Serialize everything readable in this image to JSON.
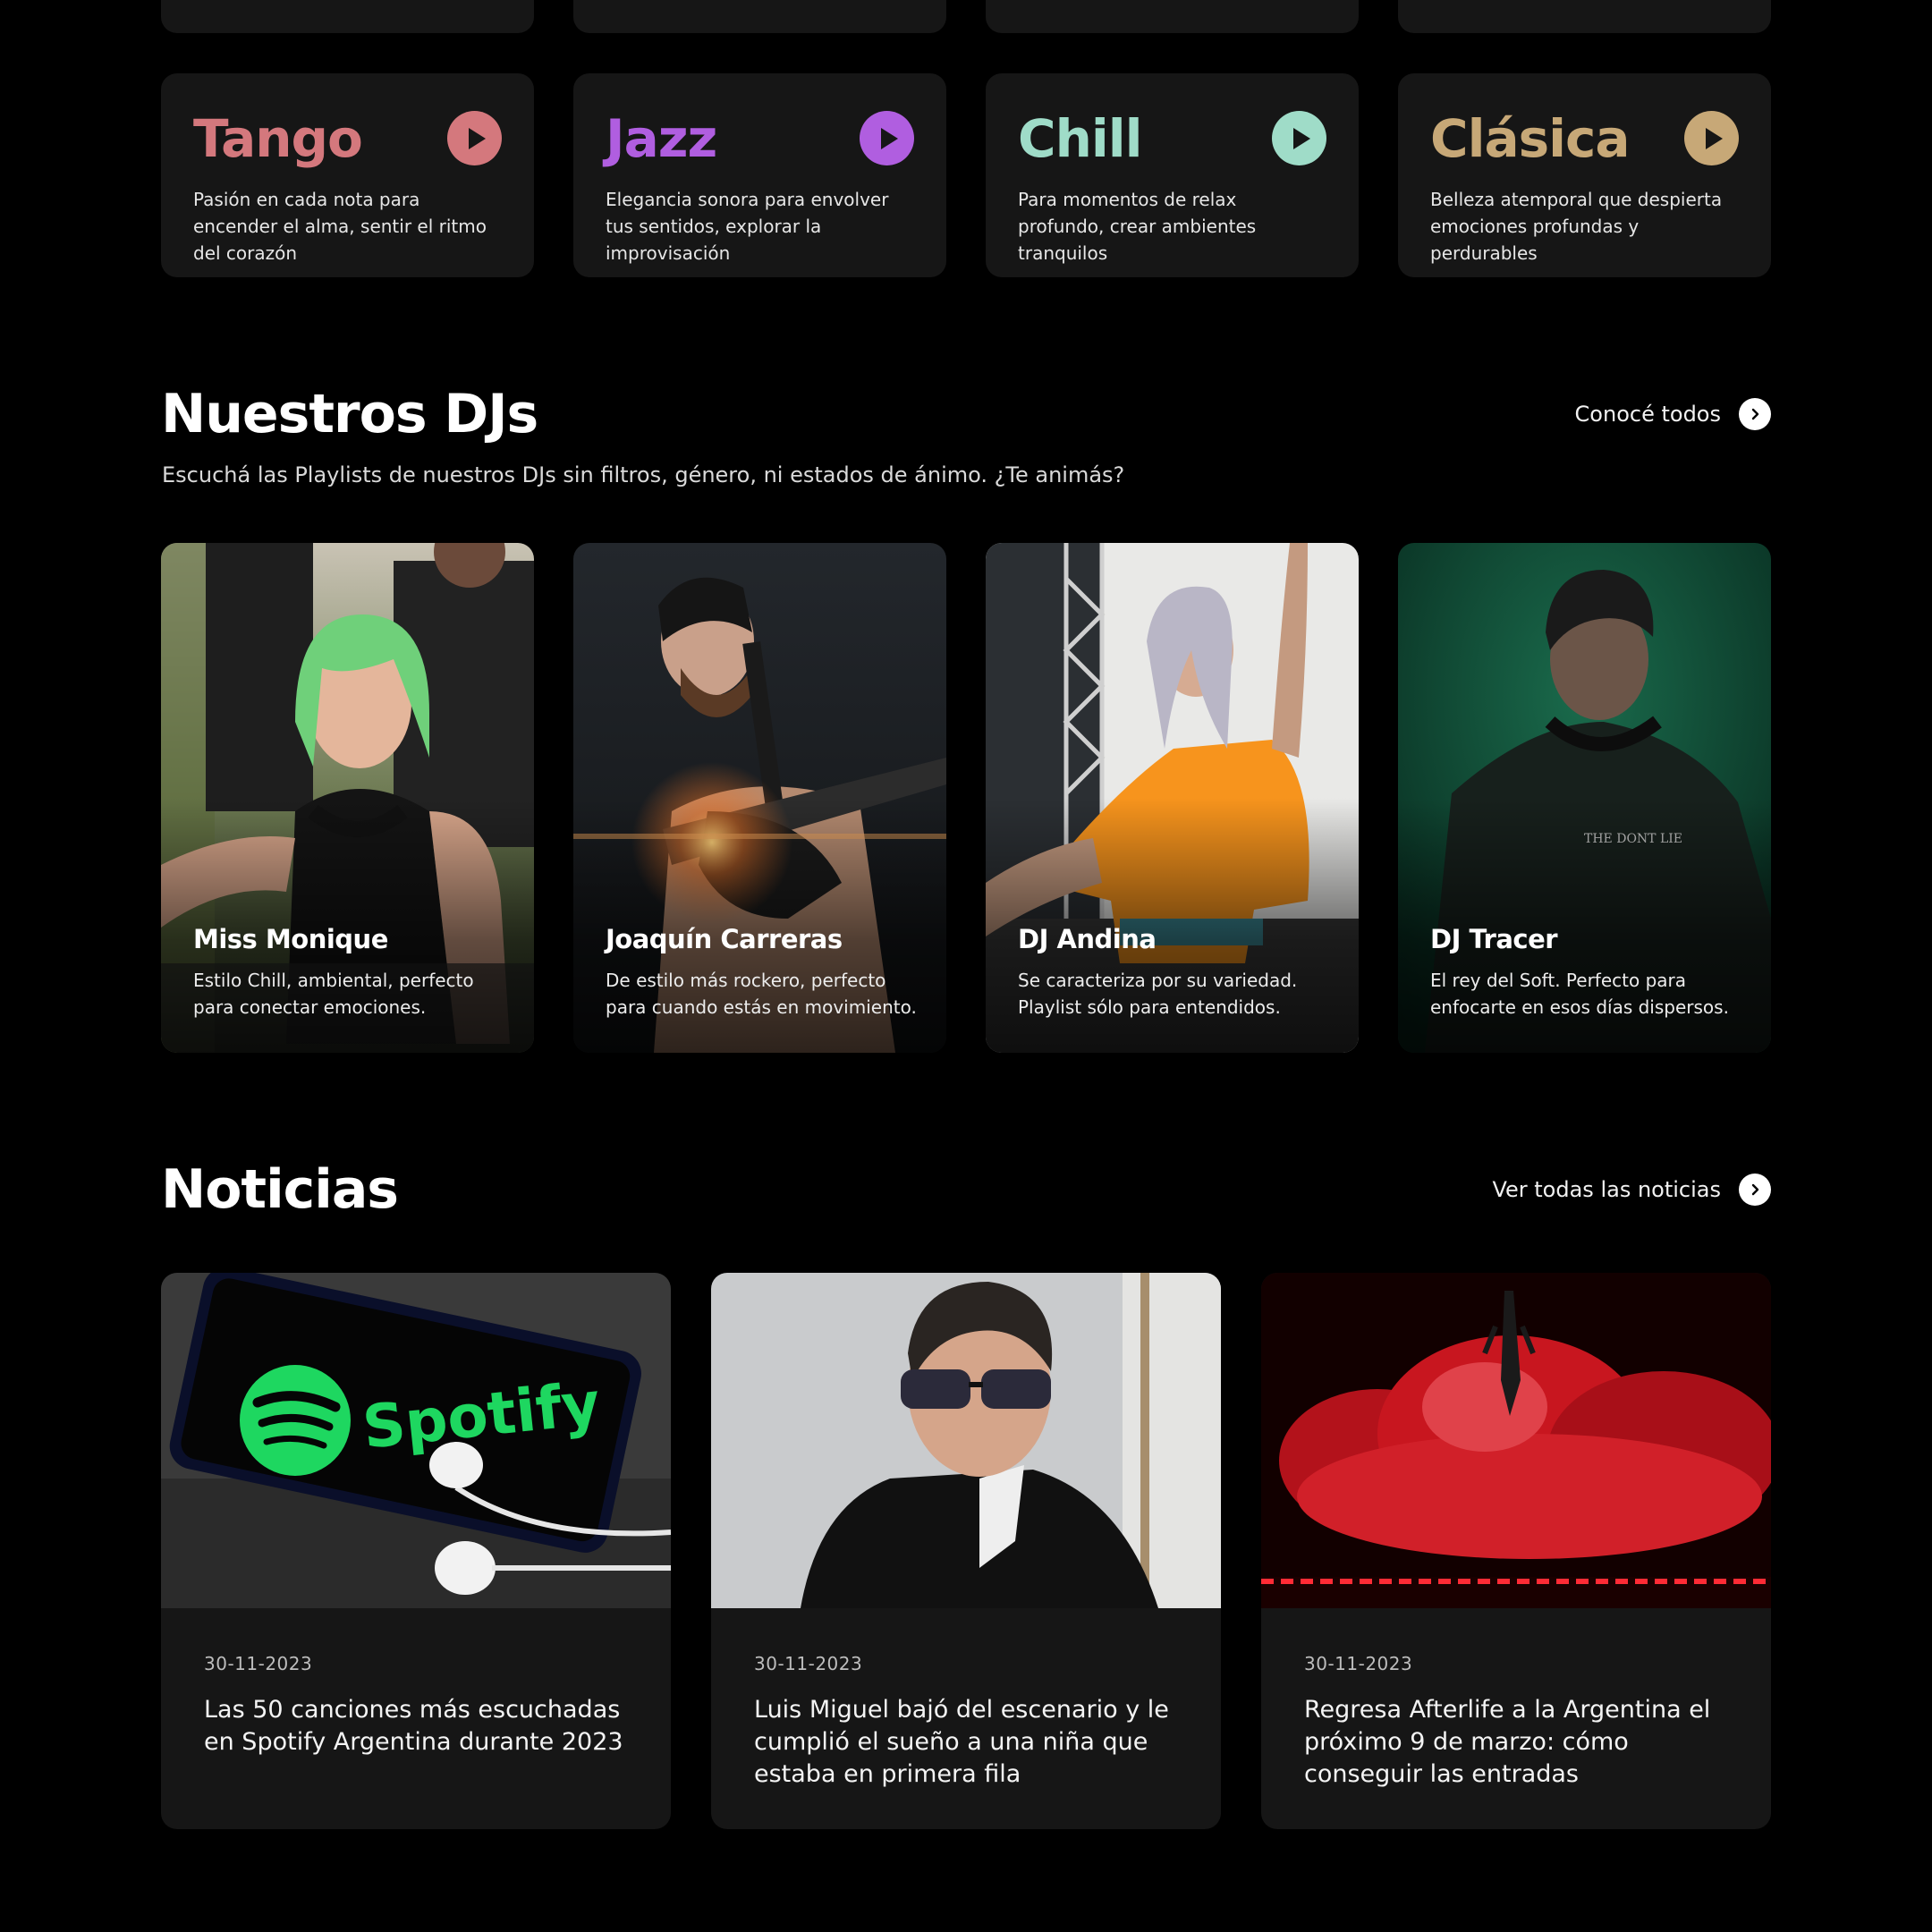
{
  "genres": [
    {
      "title": "Tango",
      "color": "#d4787d",
      "desc": "Pasión en cada nota para encender el alma, sentir el ritmo del corazón"
    },
    {
      "title": "Jazz",
      "color": "#b05ee0",
      "desc": "Elegancia sonora para envolver tus sentidos, explorar la improvisación"
    },
    {
      "title": "Chill",
      "color": "#9fdcc8",
      "desc": "Para momentos de relax profundo, crear ambientes tranquilos"
    },
    {
      "title": "Clásica",
      "color": "#c7a877",
      "desc": "Belleza atemporal que despierta emociones profundas y perdurables"
    }
  ],
  "djs_section": {
    "title": "Nuestros DJs",
    "see_all": "Conocé todos",
    "subtitle": "Escuchá las Playlists de nuestros DJs sin filtros, género, ni estados de ánimo. ¿Te animás?"
  },
  "djs": [
    {
      "name": "Miss Monique",
      "desc": "Estilo Chill, ambiental, perfecto para conectar emociones."
    },
    {
      "name": "Joaquín Carreras",
      "desc": "De estilo más rockero, perfecto para cuando estás en movimiento."
    },
    {
      "name": "DJ Andina",
      "desc": "Se caracteriza por su variedad. Playlist sólo para entendidos."
    },
    {
      "name": "DJ Tracer",
      "desc": "El rey del Soft. Perfecto para enfocarte en esos días dispersos."
    }
  ],
  "news_section": {
    "title": "Noticias",
    "see_all": "Ver todas las noticias"
  },
  "news": [
    {
      "date": "30-11-2023",
      "title": "Las 50 canciones más escuchadas en Spotify Argentina durante 2023",
      "image_text": "Spotify"
    },
    {
      "date": "30-11-2023",
      "title": "Luis Miguel bajó del escenario y le cumplió el sueño a una niña que estaba en primera fila"
    },
    {
      "date": "30-11-2023",
      "title": "Regresa Afterlife a la Argentina el próximo 9 de marzo: cómo conseguir las entradas"
    }
  ]
}
